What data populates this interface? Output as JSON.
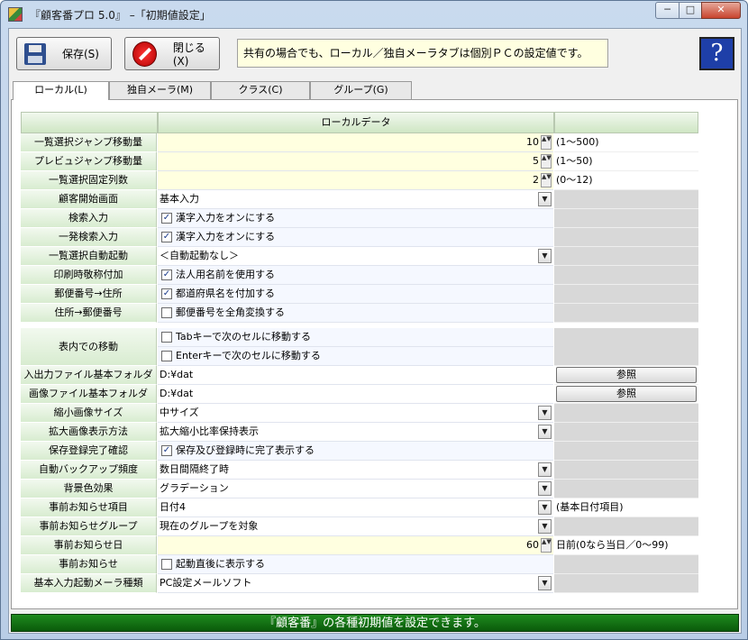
{
  "window": {
    "title": "『顧客番プロ 5.0』 –「初期値設定」",
    "min_glyph": "─",
    "max_glyph": "□",
    "close_glyph": "✕"
  },
  "toolbar": {
    "save_label": "保存(S)",
    "close_label": "閉じる(X)",
    "notice": "共有の場合でも、ローカル／独自メーラタブは個別ＰＣの設定値です。",
    "help_label": "?"
  },
  "tabs": [
    {
      "label": "ローカル(L)",
      "active": true
    },
    {
      "label": "独自メーラ(M)",
      "active": false
    },
    {
      "label": "クラス(C)",
      "active": false
    },
    {
      "label": "グループ(G)",
      "active": false
    }
  ],
  "grid": {
    "header": "ローカルデータ",
    "rows": [
      {
        "label": "一覧選択ジャンプ移動量",
        "kind": "spin",
        "value": "10",
        "note": "(1～500)"
      },
      {
        "label": "プレビュジャンプ移動量",
        "kind": "spin",
        "value": "5",
        "note": "(1～50)"
      },
      {
        "label": "一覧選択固定列数",
        "kind": "spin",
        "value": "2",
        "note": "(0～12)"
      },
      {
        "label": "顧客開始画面",
        "kind": "combo",
        "value": "基本入力",
        "note": ""
      },
      {
        "label": "検索入力",
        "kind": "check",
        "checked": true,
        "value": "漢字入力をオンにする",
        "note": ""
      },
      {
        "label": "一発検索入力",
        "kind": "check",
        "checked": true,
        "value": "漢字入力をオンにする",
        "note": ""
      },
      {
        "label": "一覧選択自動起動",
        "kind": "combo",
        "value": "＜自動起動なし＞",
        "note": ""
      },
      {
        "label": "印刷時敬称付加",
        "kind": "check",
        "checked": true,
        "value": "法人用名前を使用する",
        "note": ""
      },
      {
        "label": "郵便番号→住所",
        "kind": "check",
        "checked": true,
        "value": "都道府県名を付加する",
        "note": ""
      },
      {
        "label": "住所→郵便番号",
        "kind": "check",
        "checked": false,
        "value": "郵便番号を全角変換する",
        "note": ""
      }
    ],
    "move_row": {
      "label": "表内での移動",
      "option1": "Tabキーで次のセルに移動する",
      "option2": "Enterキーで次のセルに移動する"
    },
    "rows2": [
      {
        "label": "入出力ファイル基本フォルダ",
        "kind": "text",
        "value": "D:¥dat",
        "button": "参照"
      },
      {
        "label": "画像ファイル基本フォルダ",
        "kind": "text",
        "value": "D:¥dat",
        "button": "参照"
      },
      {
        "label": "縮小画像サイズ",
        "kind": "combo",
        "value": "中サイズ",
        "note": ""
      },
      {
        "label": "拡大画像表示方法",
        "kind": "combo",
        "value": "拡大縮小比率保持表示",
        "note": ""
      },
      {
        "label": "保存登録完了確認",
        "kind": "check",
        "checked": true,
        "value": "保存及び登録時に完了表示する",
        "note": ""
      },
      {
        "label": "自動バックアップ頻度",
        "kind": "combo",
        "value": "数日間隔終了時",
        "note": ""
      },
      {
        "label": "背景色効果",
        "kind": "combo",
        "value": "グラデーション",
        "note": ""
      },
      {
        "label": "事前お知らせ項目",
        "kind": "combo",
        "value": "日付4",
        "note": "(基本日付項目)"
      },
      {
        "label": "事前お知らせグループ",
        "kind": "combo",
        "value": "現在のグループを対象",
        "note": ""
      },
      {
        "label": "事前お知らせ日",
        "kind": "spin",
        "value": "60",
        "note": "日前(0なら当日／0～99)"
      },
      {
        "label": "事前お知らせ",
        "kind": "check",
        "checked": false,
        "value": "起動直後に表示する",
        "note": ""
      },
      {
        "label": "基本入力起動メーラ種類",
        "kind": "combo",
        "value": "PC設定メールソフト",
        "note": ""
      }
    ]
  },
  "status": "『顧客番』の各種初期値を設定できます。",
  "colors": {
    "accent_green": "#1f8a1f",
    "label_green": "#d8ecd0",
    "input_yellow": "#ffffe0",
    "help_blue": "#1e3fa8"
  }
}
